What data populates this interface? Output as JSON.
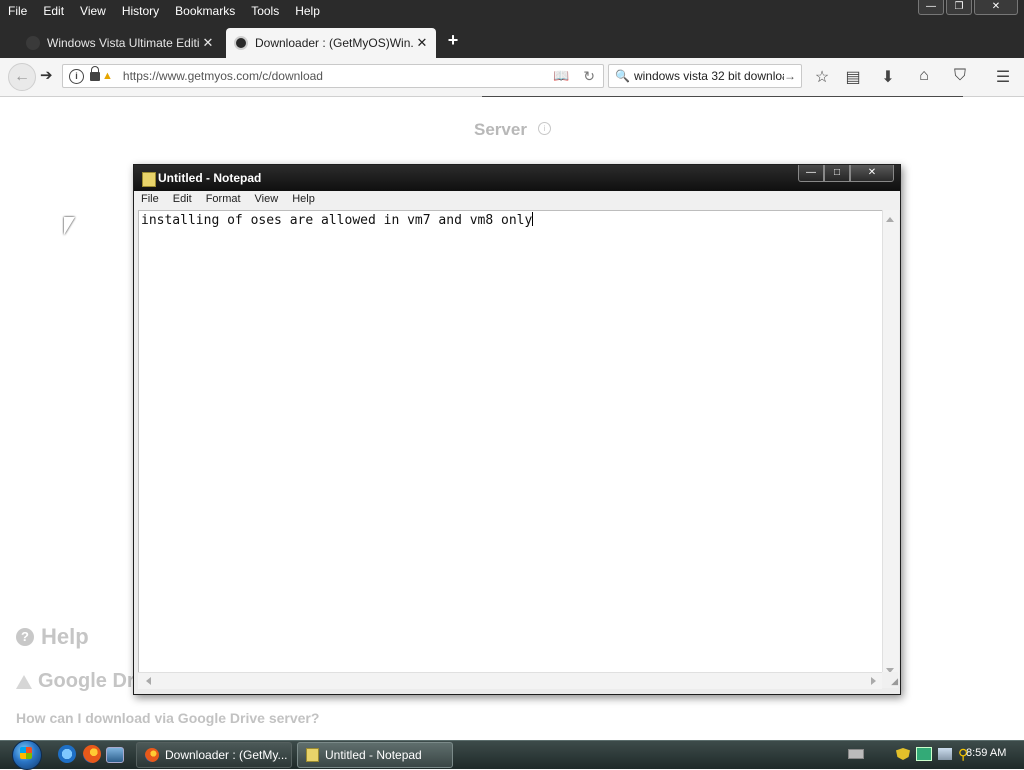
{
  "firefox": {
    "menu": [
      "File",
      "Edit",
      "View",
      "History",
      "Bookmarks",
      "Tools",
      "Help"
    ],
    "window_controls": {
      "minimize": "—",
      "restore": "❐",
      "close": "✕"
    },
    "tabs": [
      {
        "label": "Windows Vista Ultimate Editio...",
        "close": "✕"
      },
      {
        "label": "Downloader : (GetMyOS)Win...",
        "close": "✕"
      }
    ],
    "new_tab": "+",
    "url": "https://www.getmyos.com/c/download",
    "search_text": "windows vista 32 bit download",
    "icons": {
      "back": "←",
      "forward": "➔",
      "reader": "📖",
      "reload": "↻",
      "search": "🔍",
      "search_go": "→",
      "bookmark": "☆",
      "library": "▤",
      "downloads": "⬇",
      "home": "⌂",
      "pocket": "⛉",
      "menu": "☰"
    }
  },
  "page": {
    "server_heading": "Server",
    "help_heading": "Help",
    "google_drive_heading": "Google Dr",
    "google_drive_question": "How can I download via Google Drive server?"
  },
  "notepad": {
    "title": "Untitled - Notepad",
    "menu": [
      "File",
      "Edit",
      "Format",
      "View",
      "Help"
    ],
    "content": "installing of oses are allowed in vm7 and vm8 only",
    "controls": {
      "minimize": "—",
      "maximize": "□",
      "close": "✕"
    },
    "grip": "◢"
  },
  "taskbar": {
    "tasks": [
      {
        "label": "Downloader : (GetMy..."
      },
      {
        "label": "Untitled - Notepad"
      }
    ],
    "clock": "8:59 AM"
  }
}
